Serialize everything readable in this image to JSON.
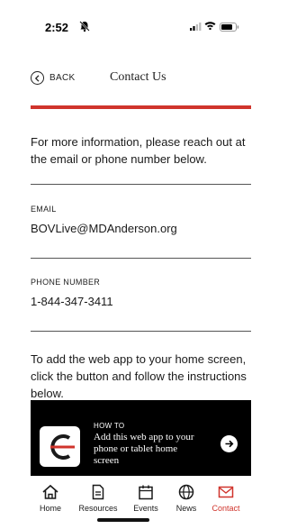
{
  "status_bar": {
    "time": "2:52"
  },
  "header": {
    "back_label": "BACK",
    "title": "Contact Us"
  },
  "intro": {
    "text": "For more information, please reach out at the email or phone number below."
  },
  "email": {
    "label": "EMAIL",
    "value": "BOVLive@MDAnderson.org"
  },
  "phone": {
    "label": "PHONE NUMBER",
    "value": "1-844-347-3411"
  },
  "instructions": {
    "text": "To add the web app to your home screen, click the button and follow the instructions below."
  },
  "howto_card": {
    "kicker": "HOW TO",
    "text": "Add this web app to your phone or tablet home screen"
  },
  "bottom_nav": {
    "items": [
      {
        "label": "Home",
        "icon": "home-icon",
        "active": false
      },
      {
        "label": "Resources",
        "icon": "document-icon",
        "active": false
      },
      {
        "label": "Events",
        "icon": "calendar-icon",
        "active": false
      },
      {
        "label": "News",
        "icon": "globe-icon",
        "active": false
      },
      {
        "label": "Contact",
        "icon": "mail-icon",
        "active": true
      }
    ]
  },
  "colors": {
    "accent": "#d0342c",
    "card_bg": "#000000",
    "text": "#1a1a1a"
  }
}
